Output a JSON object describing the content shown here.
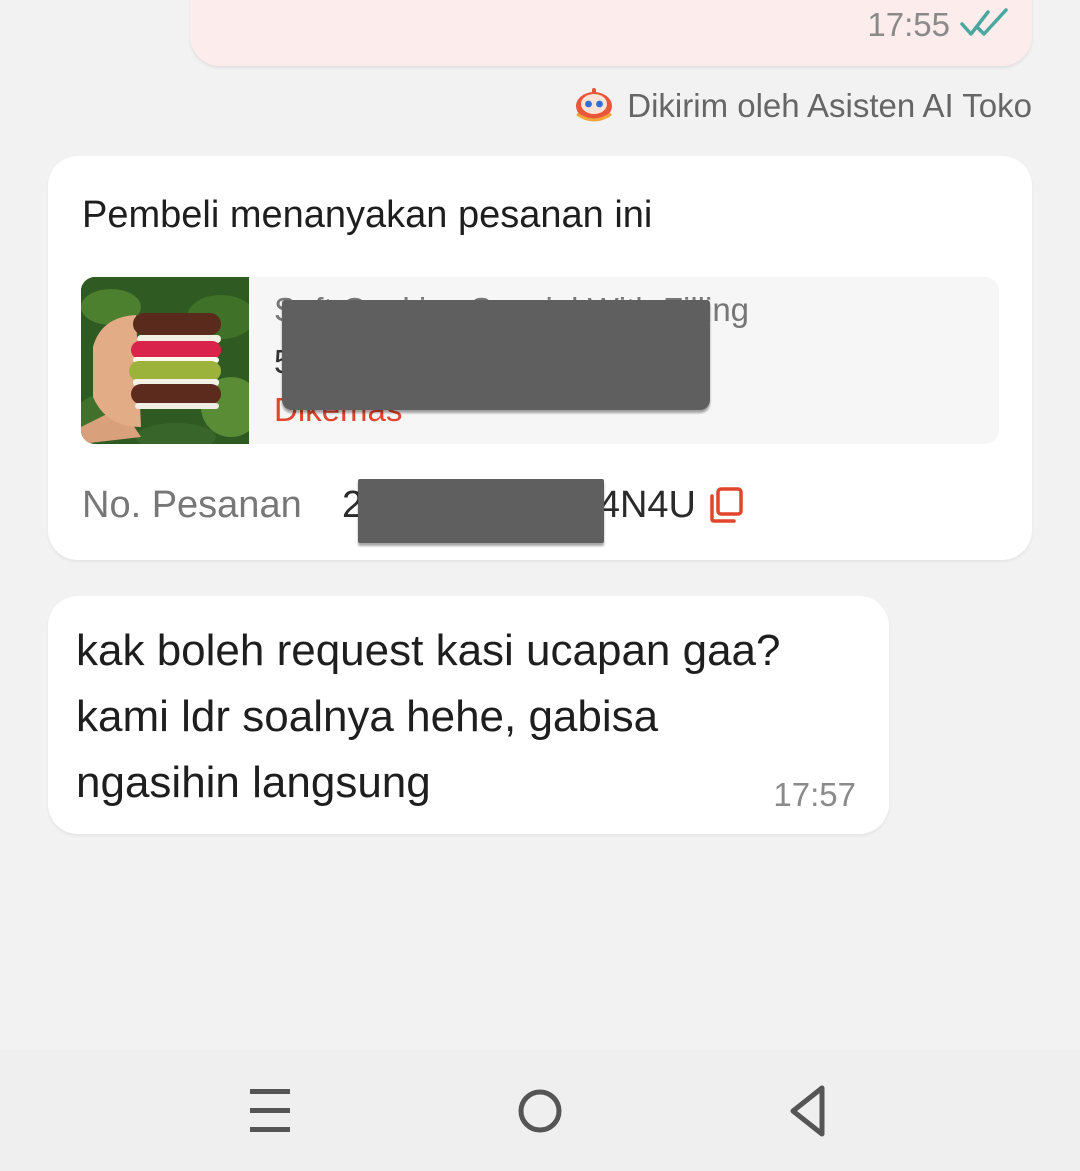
{
  "sent_message": {
    "time": "17:55",
    "status_icon": "double-check-icon",
    "status_color": "#4aa8a0"
  },
  "ai_note": {
    "icon": "ai-assistant-robot-icon",
    "text": "Dikirim oleh Asisten AI Toko"
  },
  "order_card": {
    "title": "Pembeli menanyakan pesanan ini",
    "product": {
      "name": "Soft Cookies Special With Filling",
      "quantity": "5",
      "status": "Dikemas",
      "status_color": "#e2452c"
    },
    "order_label": "No. Pesanan",
    "order_number_prefix": "2",
    "order_number_suffix": "4N4U",
    "copy_icon": "copy-icon",
    "accent_color": "#e2452c"
  },
  "received_message": {
    "text": "kak boleh request kasi ucapan gaa? kami ldr soalnya hehe, gabisa ngasihin langsung",
    "time": "17:57"
  },
  "navbar": {
    "menu_icon": "menu-icon",
    "home_icon": "home-circle-icon",
    "back_icon": "back-triangle-icon"
  }
}
